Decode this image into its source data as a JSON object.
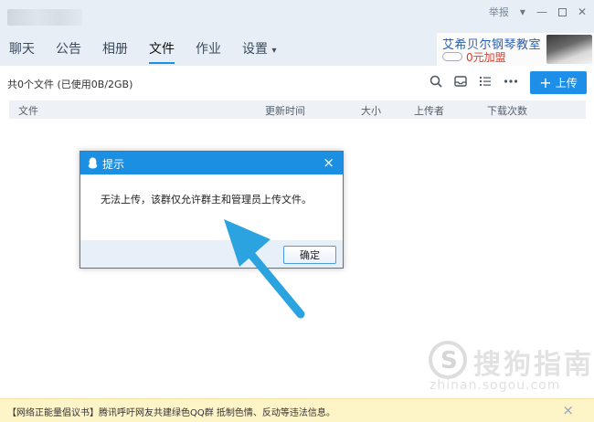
{
  "window": {
    "report_label": "举报",
    "tabs": [
      {
        "label": "聊天",
        "active": false
      },
      {
        "label": "公告",
        "active": false
      },
      {
        "label": "相册",
        "active": false
      },
      {
        "label": "文件",
        "active": true
      },
      {
        "label": "作业",
        "active": false
      },
      {
        "label": "设置",
        "active": false
      }
    ],
    "settings_caret": "▾"
  },
  "ad": {
    "title": "艾希贝尔钢琴教室",
    "subtitle": "0元加盟"
  },
  "files": {
    "count_text": "共0个文件 (已使用0B/2GB)",
    "upload_label": "上传",
    "columns": [
      "文件",
      "更新时间",
      "大小",
      "上传者",
      "下载次数"
    ]
  },
  "dialog": {
    "title": "提示",
    "message": "无法上传，该群仅允许群主和管理员上传文件。",
    "ok_label": "确定",
    "close_glyph": "×"
  },
  "watermark": {
    "text": "搜狗指南",
    "url": "zhinan.sogou.com"
  },
  "notice": {
    "text": "【网络正能量倡议书】腾讯呼吁网友共建绿色QQ群 抵制色情、反动等违法信息。",
    "close_glyph": "×"
  },
  "colors": {
    "accent": "#1b8fe2",
    "arrow": "#2ba3e0",
    "notice_bg": "#fdf4c8",
    "ad_price": "#e03a2a"
  }
}
